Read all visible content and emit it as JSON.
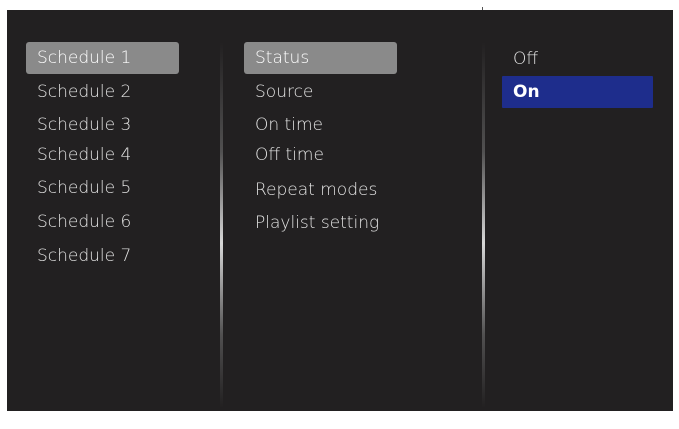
{
  "schedules": {
    "items": [
      {
        "label": "Schedule 1"
      },
      {
        "label": "Schedule 2"
      },
      {
        "label": "Schedule 3"
      },
      {
        "label": "Schedule 4"
      },
      {
        "label": "Schedule 5"
      },
      {
        "label": "Schedule 6"
      },
      {
        "label": "Schedule 7"
      }
    ],
    "selected": "Schedule 1"
  },
  "settings": {
    "items": [
      {
        "label": "Status"
      },
      {
        "label": "Source"
      },
      {
        "label": "On time"
      },
      {
        "label": "Off time"
      },
      {
        "label": "Repeat modes"
      },
      {
        "label": "Playlist setting"
      }
    ],
    "selected": "Status"
  },
  "options": {
    "items": [
      {
        "label": "Off"
      },
      {
        "label": "On"
      }
    ],
    "selected": "On"
  },
  "colors": {
    "background": "#222021",
    "text": "#e3e3e3",
    "grey_highlight": "#8a8a8a",
    "blue_highlight": "#1e2d8c"
  }
}
